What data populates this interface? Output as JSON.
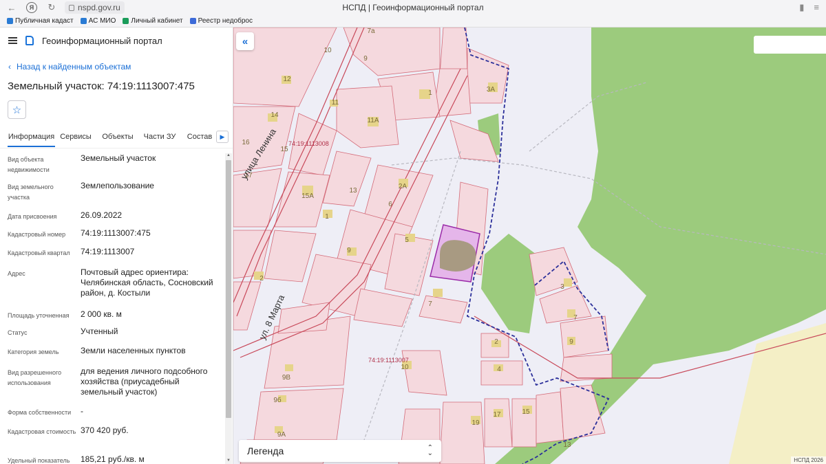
{
  "browser": {
    "url": "nspd.gov.ru",
    "page_title": "НСПД | Геоинформационный портал",
    "bookmarks": [
      {
        "label": "Публичная кадаст",
        "color": "#2a7bd4"
      },
      {
        "label": "АС МИО",
        "color": "#2a7bd4"
      },
      {
        "label": "Личный кабинет",
        "color": "#1b9c5a"
      },
      {
        "label": "Реестр недоброс",
        "color": "#3c6ad8"
      }
    ]
  },
  "panel": {
    "portal_name": "Геоинформационный портал",
    "back_label": "Назад к найденным объектам",
    "object_title": "Земельный участок: 74:19:1113007:475",
    "tabs": [
      "Информация",
      "Сервисы",
      "Объекты",
      "Части ЗУ",
      "Состав"
    ],
    "active_tab": "Информация",
    "properties": [
      {
        "label": "Вид объекта недвижимости",
        "value": "Земельный участок"
      },
      {
        "label": "Вид земельного участка",
        "value": "Землепользование"
      },
      {
        "label": "Дата присвоения",
        "value": "26.09.2022"
      },
      {
        "label": "Кадастровый номер",
        "value": "74:19:1113007:475"
      },
      {
        "label": "Кадастровый квартал",
        "value": "74:19:1113007"
      },
      {
        "label": "Адрес",
        "value": "Почтовый адрес ориентира: Челябинская область, Сосновский район, д. Костыли"
      },
      {
        "label": "Площадь уточненная",
        "value": "2 000 кв. м"
      },
      {
        "label": "Статус",
        "value": "Учтенный"
      },
      {
        "label": "Категория земель",
        "value": "Земли населенных пунктов"
      },
      {
        "label": "Вид разрешенного использования",
        "value": "для ведения личного подсобного хозяйства (приусадебный земельный участок)"
      },
      {
        "label": "Форма собственности",
        "value": "-"
      },
      {
        "label": "Кадастровая стоимость",
        "value": "370 420 руб."
      },
      {
        "label": "Удельный показатель",
        "value": "185,21 руб./кв. м"
      }
    ]
  },
  "map": {
    "legend_label": "Легенда",
    "copyright": "НСПД 2026",
    "street_labels": [
      "улица Ленина",
      "ул. 8 Марта"
    ],
    "quarter_labels": [
      "74:19:1113008",
      "74:19:1113007"
    ],
    "house_numbers": [
      "7а",
      "10",
      "9",
      "1",
      "3А",
      "12",
      "11",
      "14",
      "11А",
      "16",
      "15",
      "17",
      "13",
      "2А",
      "15А",
      "6",
      "1",
      "5",
      "9",
      "2",
      "7",
      "3",
      "7",
      "9",
      "2",
      "4",
      "10",
      "9В",
      "9б",
      "9А",
      "19",
      "17",
      "15",
      "13"
    ],
    "colors": {
      "parcel_fill": "#f5d9de",
      "parcel_stroke": "#d36a78",
      "forest": "#9ccb7d",
      "selected": "#c86fd2",
      "boundary_blue": "#2b2f9a",
      "background": "#eeeef6"
    }
  }
}
